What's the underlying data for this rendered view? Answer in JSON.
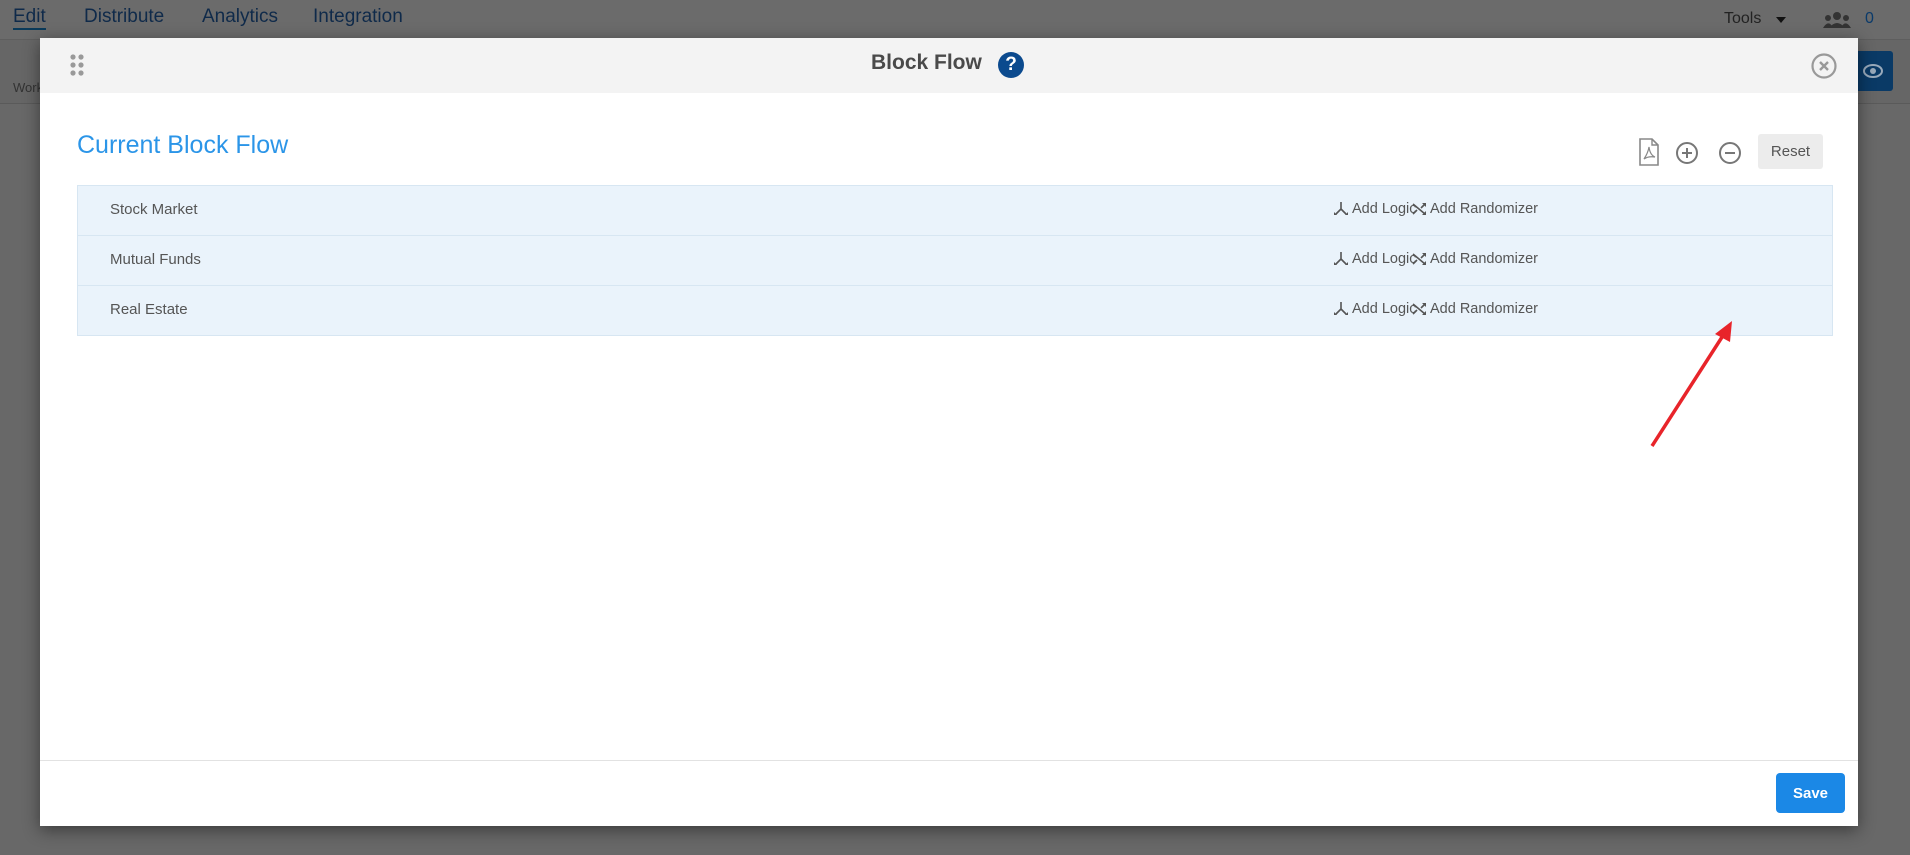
{
  "topnav": {
    "items": [
      {
        "label": "Edit",
        "active": true
      },
      {
        "label": "Distribute"
      },
      {
        "label": "Analytics"
      },
      {
        "label": "Integration"
      }
    ],
    "tools_label": "Tools",
    "collaborators_count": "0"
  },
  "toolbar": {
    "work_label": "Work"
  },
  "modal": {
    "title": "Block Flow",
    "help_label": "?",
    "section_title": "Current Block Flow",
    "reset_label": "Reset",
    "save_label": "Save",
    "blocks": [
      {
        "name": "Stock Market",
        "add_logic": "Add Logic",
        "add_randomizer": "Add Randomizer"
      },
      {
        "name": "Mutual Funds",
        "add_logic": "Add Logic",
        "add_randomizer": "Add Randomizer"
      },
      {
        "name": "Real Estate",
        "add_logic": "Add Logic",
        "add_randomizer": "Add Randomizer"
      }
    ]
  },
  "colors": {
    "accent": "#2b95e8",
    "save": "#1b88e6",
    "help": "#0b4a8e",
    "annotation_arrow": "#e8242a"
  }
}
